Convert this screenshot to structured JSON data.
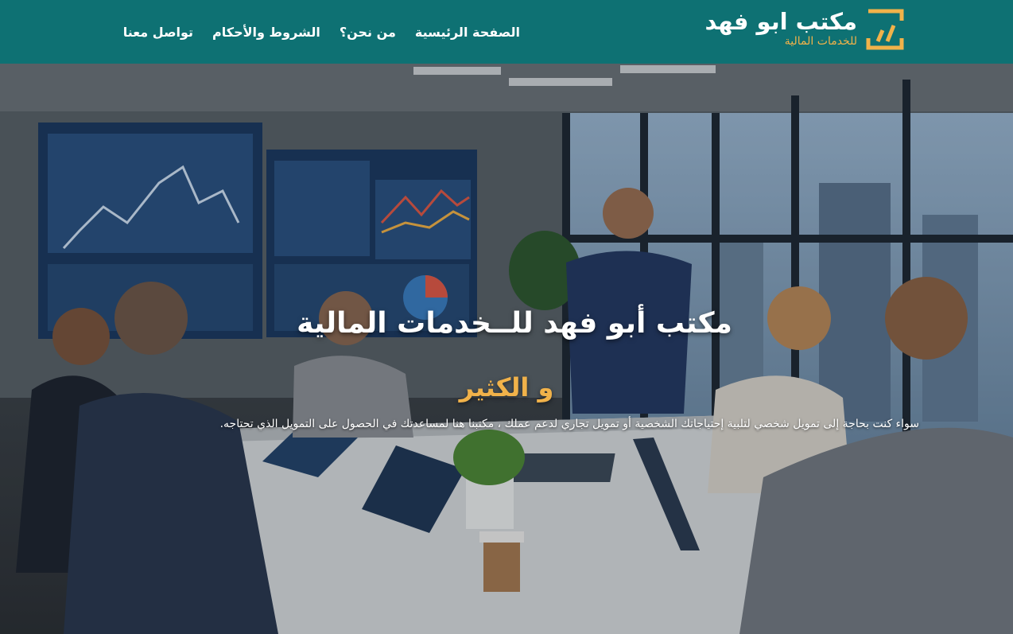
{
  "header": {
    "logo": {
      "title": "مكتب ابو فهد",
      "subtitle": "للخدمات المالية",
      "mark_icon": "chart-bars-icon",
      "mark_color": "#f1b24a"
    },
    "nav": [
      {
        "label": "الصفحة الرئيسية"
      },
      {
        "label": "من نحن؟"
      },
      {
        "label": "الشروط والأحكام"
      },
      {
        "label": "تواصل معنا"
      }
    ],
    "background_color": "#0e7173"
  },
  "hero": {
    "title": "مكتب أبو فهد للــخدمات المالية",
    "subtitle": "و الكثير",
    "text": "سواء كنت بحاجة إلى تمويل شخصي لتلبية إحتياجاتك الشخصية أو تمويل تجاري لدعم عملك ، مكتبنا هنا لمساعدتك في الحصول على التمويل الذي تحتاجه.",
    "image_subject": "business-meeting-photo",
    "accent_color": "#f1b24a"
  }
}
